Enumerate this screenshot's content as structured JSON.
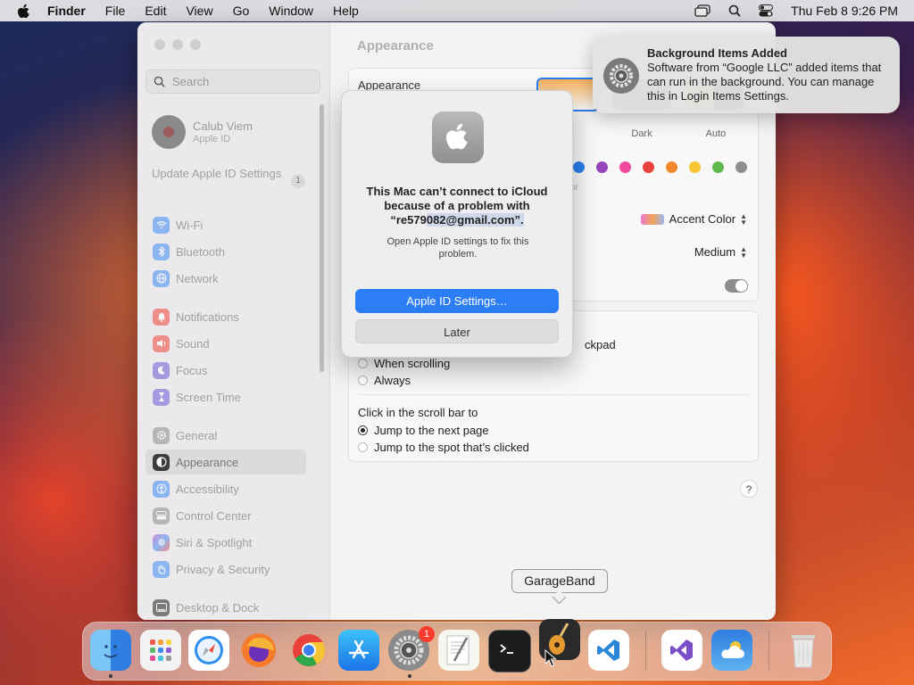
{
  "menubar": {
    "app": "Finder",
    "menus": [
      "File",
      "Edit",
      "View",
      "Go",
      "Window",
      "Help"
    ],
    "clock": "Thu Feb 8  9:26 PM",
    "status_icons": [
      "display-icon",
      "search-icon",
      "control-center-icon"
    ]
  },
  "sidebar": {
    "search_placeholder": "Search",
    "account_name": "Calub Viem",
    "account_sub": "Apple ID",
    "update_label": "Update Apple ID Settings",
    "update_badge": "1",
    "items": [
      {
        "label": "Wi-Fi",
        "icon": "wifi-icon",
        "color": "#3b8cf5"
      },
      {
        "label": "Bluetooth",
        "icon": "bluetooth-icon",
        "color": "#3b8cf5"
      },
      {
        "label": "Network",
        "icon": "globe-icon",
        "color": "#3b8cf5"
      },
      {
        "label": "Notifications",
        "icon": "bell-icon",
        "color": "#f0443a"
      },
      {
        "label": "Sound",
        "icon": "speaker-icon",
        "color": "#f0443a"
      },
      {
        "label": "Focus",
        "icon": "moon-icon",
        "color": "#6a5bd6"
      },
      {
        "label": "Screen Time",
        "icon": "hourglass-icon",
        "color": "#6a5bd6"
      },
      {
        "label": "General",
        "icon": "gear-icon",
        "color": "#8e8e8e"
      },
      {
        "label": "Appearance",
        "icon": "appearance-icon",
        "color": "#222222"
      },
      {
        "label": "Accessibility",
        "icon": "accessibility-icon",
        "color": "#3b8cf5"
      },
      {
        "label": "Control Center",
        "icon": "control-center-icon",
        "color": "#8e8e8e"
      },
      {
        "label": "Siri & Spotlight",
        "icon": "siri-icon",
        "color": "#c04bd0"
      },
      {
        "label": "Privacy & Security",
        "icon": "hand-icon",
        "color": "#3b8cf5"
      },
      {
        "label": "Desktop & Dock",
        "icon": "dock-icon",
        "color": "#222222"
      }
    ]
  },
  "content": {
    "title": "Appearance",
    "appearance_label": "Appearance",
    "options": [
      "ht",
      "Dark",
      "Auto"
    ],
    "accent_colors": [
      "#2a7ef0",
      "#9645b8",
      "#f04a9e",
      "#e8423b",
      "#f3872b",
      "#f6c533",
      "#5eb84a",
      "#8e8e8e"
    ],
    "accent_caption": "or",
    "highlight_label": "Accent Color",
    "sidebar_size": "Medium",
    "trackpad_suffix": "ckpad",
    "show_scroll": [
      {
        "label": "When scrolling",
        "selected": false
      },
      {
        "label": "Always",
        "selected": false
      }
    ],
    "click_title": "Click in the scroll bar to",
    "click_options": [
      {
        "label": "Jump to the next page",
        "selected": true
      },
      {
        "label": "Jump to the spot that’s clicked",
        "selected": false
      }
    ],
    "help": "?"
  },
  "dialog": {
    "message_prefix": "This Mac can’t connect to iCloud because of a problem with “re579",
    "message_highlight": "082@gmail.com”.",
    "info": "Open Apple ID settings to fix this problem.",
    "primary_button": "Apple ID Settings…",
    "secondary_button": "Later"
  },
  "notification": {
    "title": "Background Items Added",
    "body": "Software from “Google LLC” added items that can run in the background. You can manage this in Login Items Settings."
  },
  "tooltip": "GarageBand",
  "dock": {
    "apps": [
      "finder-icon",
      "launchpad-icon",
      "safari-icon",
      "firefox-icon",
      "chrome-icon",
      "app-store-icon",
      "system-settings-icon",
      "textedit-icon",
      "terminal-icon",
      "garageband-icon",
      "vscode-icon",
      "visual-studio-icon",
      "weather-icon",
      "trash-icon"
    ],
    "settings_badge": "1"
  }
}
